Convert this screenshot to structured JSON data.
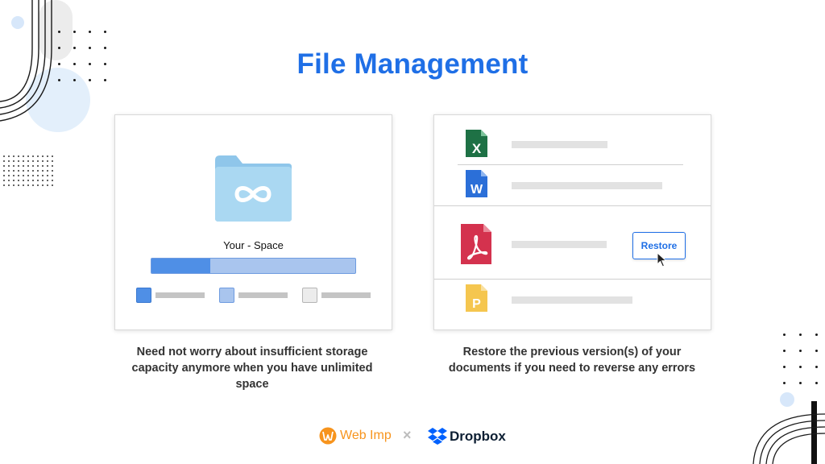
{
  "title": "File Management",
  "colors": {
    "accent": "#1f6fe6",
    "folder": "#aad8f2",
    "excel": "#1e7145",
    "word": "#2b6fd8",
    "pdf": "#d4324e",
    "ppt": "#f5c64f",
    "webimp": "#f7941d",
    "dropbox": "#0061fe"
  },
  "storage_card": {
    "folder_icon": "folder-infinity-icon",
    "space_label": "Your - Space",
    "used_fraction": 0.29
  },
  "versions_card": {
    "files": [
      {
        "type": "excel",
        "letter": "X"
      },
      {
        "type": "word",
        "letter": "W"
      },
      {
        "type": "pdf",
        "letter": ""
      },
      {
        "type": "powerpoint",
        "letter": "P"
      }
    ],
    "restore_label": "Restore"
  },
  "captions": {
    "left": "Need not worry about insufficient storage capacity anymore when you have unlimited space",
    "right": "Restore the previous version(s) of your documents if you need to reverse any errors"
  },
  "footer": {
    "webimp": "Web Imp",
    "separator": "×",
    "dropbox": "Dropbox"
  }
}
